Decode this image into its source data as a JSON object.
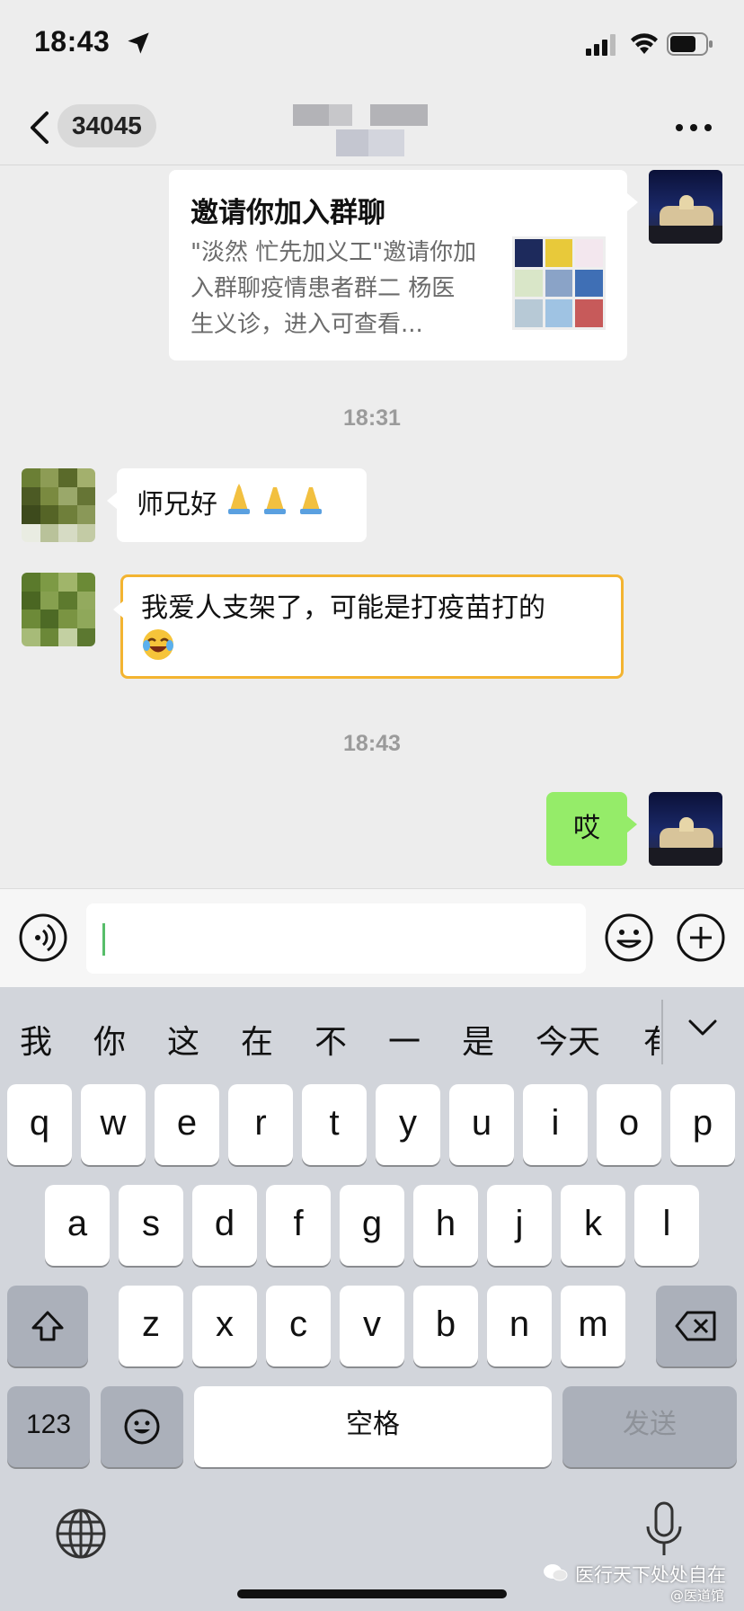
{
  "status_bar": {
    "time": "18:43"
  },
  "nav": {
    "unread_count": "34045"
  },
  "messages": {
    "invite": {
      "title": "邀请你加入群聊",
      "desc": "\"淡然 忙先加义工\"邀请你加入群聊疫情患者群二 杨医生义诊，进入可查看..."
    },
    "time1": "18:31",
    "msg1": "师兄好",
    "msg2": "我爱人支架了，可能是打疫苗打的",
    "time2": "18:43",
    "msg3": "哎"
  },
  "input": {
    "value": ""
  },
  "keyboard": {
    "candidates": [
      "我",
      "你",
      "这",
      "在",
      "不",
      "一",
      "是",
      "今天",
      "有"
    ],
    "row1": [
      "q",
      "w",
      "e",
      "r",
      "t",
      "y",
      "u",
      "i",
      "o",
      "p"
    ],
    "row2": [
      "a",
      "s",
      "d",
      "f",
      "g",
      "h",
      "j",
      "k",
      "l"
    ],
    "row3": [
      "z",
      "x",
      "c",
      "v",
      "b",
      "n",
      "m"
    ],
    "num_label": "123",
    "space_label": "空格",
    "send_label": "发送"
  },
  "watermark": {
    "main": "医行天下处处自在",
    "sub": "@医道馆"
  },
  "colors": {
    "self_bubble": "#95ec69",
    "highlight_border": "#f3b431",
    "keyboard_bg": "#d2d5db"
  },
  "icons": [
    "location-arrow-icon",
    "signal-icon",
    "wifi-icon",
    "battery-icon",
    "back-icon",
    "more-icon",
    "voice-icon",
    "emoji-icon",
    "plus-icon",
    "shift-icon",
    "backspace-icon",
    "globe-icon",
    "microphone-icon"
  ]
}
